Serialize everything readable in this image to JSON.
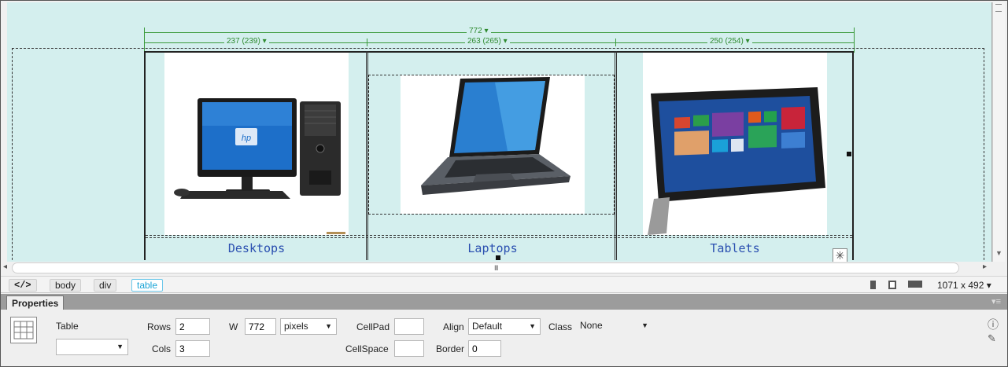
{
  "table_widths": {
    "total": "772",
    "col1": "237 (239)",
    "col2": "263 (265)",
    "col3": "250 (254)"
  },
  "products": [
    {
      "caption": "Desktops"
    },
    {
      "caption": "Laptops"
    },
    {
      "caption": "Tablets"
    }
  ],
  "hscroll_grip": "III",
  "tag_selector": {
    "code_toggle": "</>",
    "crumbs": [
      "body",
      "div",
      "table"
    ],
    "window_size": "1071 x 492"
  },
  "properties": {
    "tab_label": "Properties",
    "element_type": "Table",
    "rows_label": "Rows",
    "rows_value": "2",
    "cols_label": "Cols",
    "cols_value": "3",
    "w_label": "W",
    "w_value": "772",
    "w_unit": "pixels",
    "cellpad_label": "CellPad",
    "cellpad_value": "",
    "cellspace_label": "CellSpace",
    "cellspace_value": "",
    "align_label": "Align",
    "align_value": "Default",
    "border_label": "Border",
    "border_value": "0",
    "class_label": "Class",
    "class_value": "None",
    "table_id_value": ""
  },
  "colors": {
    "design_bg": "#d4efee",
    "measure_green": "#3a9a3a",
    "caption_blue": "#2a4fb0",
    "active_crumb": "#1aa4d6"
  }
}
